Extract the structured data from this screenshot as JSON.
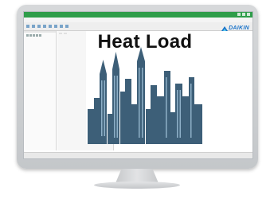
{
  "overlay": {
    "title": "Heat Load"
  },
  "brand": {
    "name": "DAIKIN",
    "color": "#1a73c9"
  },
  "app": {
    "title_bar_color": "#2f9d4a"
  },
  "colors": {
    "skyline": "#3d5f78",
    "skyline_light": "#8eb0c8"
  }
}
